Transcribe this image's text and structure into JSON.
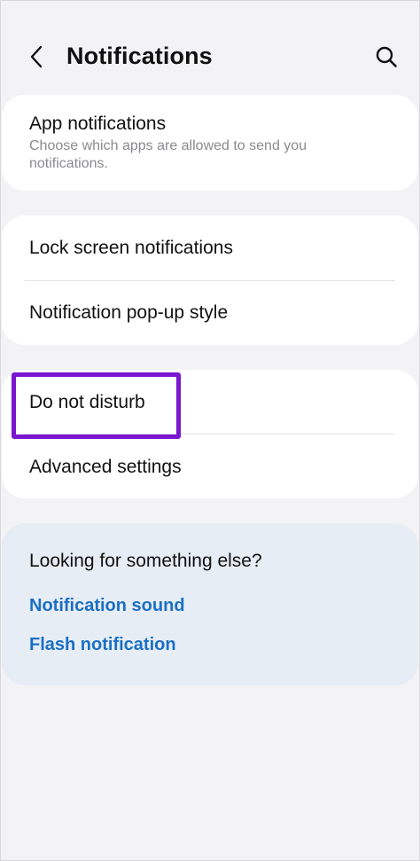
{
  "header": {
    "title": "Notifications",
    "back_icon": "chevron-left-icon",
    "search_icon": "search-icon"
  },
  "sections": {
    "app_notifications": {
      "label": "App notifications",
      "subtitle": "Choose which apps are allowed to send you notifications."
    },
    "lock_screen": {
      "label": "Lock screen notifications"
    },
    "popup_style": {
      "label": "Notification pop-up style"
    },
    "do_not_disturb": {
      "label": "Do not disturb"
    },
    "advanced": {
      "label": "Advanced settings"
    }
  },
  "suggestions": {
    "title": "Looking for something else?",
    "links": [
      "Notification sound",
      "Flash notification"
    ]
  },
  "colors": {
    "background": "#f3f3f5",
    "card": "#ffffff",
    "suggestion_card": "#e7edf4",
    "link": "#1a6fc4",
    "highlight": "#7a16cf"
  }
}
